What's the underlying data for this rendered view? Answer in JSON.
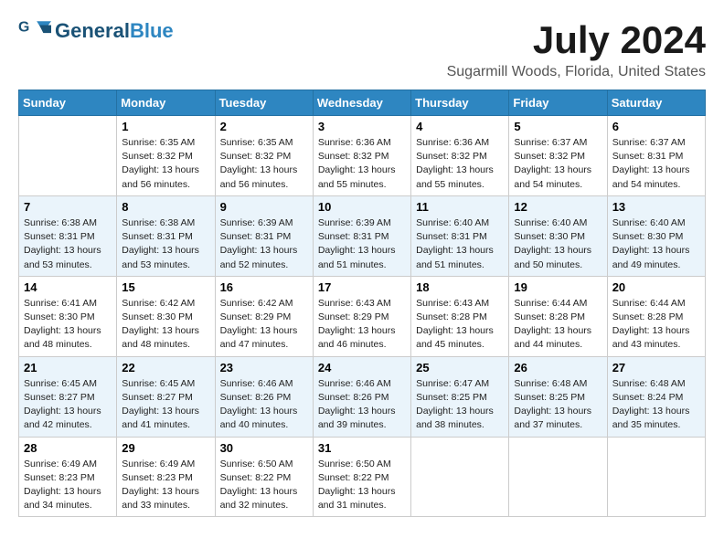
{
  "header": {
    "logo_general": "General",
    "logo_blue": "Blue",
    "month_title": "July 2024",
    "location": "Sugarmill Woods, Florida, United States"
  },
  "calendar": {
    "days_of_week": [
      "Sunday",
      "Monday",
      "Tuesday",
      "Wednesday",
      "Thursday",
      "Friday",
      "Saturday"
    ],
    "weeks": [
      [
        {
          "day": "",
          "info": ""
        },
        {
          "day": "1",
          "info": "Sunrise: 6:35 AM\nSunset: 8:32 PM\nDaylight: 13 hours\nand 56 minutes."
        },
        {
          "day": "2",
          "info": "Sunrise: 6:35 AM\nSunset: 8:32 PM\nDaylight: 13 hours\nand 56 minutes."
        },
        {
          "day": "3",
          "info": "Sunrise: 6:36 AM\nSunset: 8:32 PM\nDaylight: 13 hours\nand 55 minutes."
        },
        {
          "day": "4",
          "info": "Sunrise: 6:36 AM\nSunset: 8:32 PM\nDaylight: 13 hours\nand 55 minutes."
        },
        {
          "day": "5",
          "info": "Sunrise: 6:37 AM\nSunset: 8:32 PM\nDaylight: 13 hours\nand 54 minutes."
        },
        {
          "day": "6",
          "info": "Sunrise: 6:37 AM\nSunset: 8:31 PM\nDaylight: 13 hours\nand 54 minutes."
        }
      ],
      [
        {
          "day": "7",
          "info": "Sunrise: 6:38 AM\nSunset: 8:31 PM\nDaylight: 13 hours\nand 53 minutes."
        },
        {
          "day": "8",
          "info": "Sunrise: 6:38 AM\nSunset: 8:31 PM\nDaylight: 13 hours\nand 53 minutes."
        },
        {
          "day": "9",
          "info": "Sunrise: 6:39 AM\nSunset: 8:31 PM\nDaylight: 13 hours\nand 52 minutes."
        },
        {
          "day": "10",
          "info": "Sunrise: 6:39 AM\nSunset: 8:31 PM\nDaylight: 13 hours\nand 51 minutes."
        },
        {
          "day": "11",
          "info": "Sunrise: 6:40 AM\nSunset: 8:31 PM\nDaylight: 13 hours\nand 51 minutes."
        },
        {
          "day": "12",
          "info": "Sunrise: 6:40 AM\nSunset: 8:30 PM\nDaylight: 13 hours\nand 50 minutes."
        },
        {
          "day": "13",
          "info": "Sunrise: 6:40 AM\nSunset: 8:30 PM\nDaylight: 13 hours\nand 49 minutes."
        }
      ],
      [
        {
          "day": "14",
          "info": "Sunrise: 6:41 AM\nSunset: 8:30 PM\nDaylight: 13 hours\nand 48 minutes."
        },
        {
          "day": "15",
          "info": "Sunrise: 6:42 AM\nSunset: 8:30 PM\nDaylight: 13 hours\nand 48 minutes."
        },
        {
          "day": "16",
          "info": "Sunrise: 6:42 AM\nSunset: 8:29 PM\nDaylight: 13 hours\nand 47 minutes."
        },
        {
          "day": "17",
          "info": "Sunrise: 6:43 AM\nSunset: 8:29 PM\nDaylight: 13 hours\nand 46 minutes."
        },
        {
          "day": "18",
          "info": "Sunrise: 6:43 AM\nSunset: 8:28 PM\nDaylight: 13 hours\nand 45 minutes."
        },
        {
          "day": "19",
          "info": "Sunrise: 6:44 AM\nSunset: 8:28 PM\nDaylight: 13 hours\nand 44 minutes."
        },
        {
          "day": "20",
          "info": "Sunrise: 6:44 AM\nSunset: 8:28 PM\nDaylight: 13 hours\nand 43 minutes."
        }
      ],
      [
        {
          "day": "21",
          "info": "Sunrise: 6:45 AM\nSunset: 8:27 PM\nDaylight: 13 hours\nand 42 minutes."
        },
        {
          "day": "22",
          "info": "Sunrise: 6:45 AM\nSunset: 8:27 PM\nDaylight: 13 hours\nand 41 minutes."
        },
        {
          "day": "23",
          "info": "Sunrise: 6:46 AM\nSunset: 8:26 PM\nDaylight: 13 hours\nand 40 minutes."
        },
        {
          "day": "24",
          "info": "Sunrise: 6:46 AM\nSunset: 8:26 PM\nDaylight: 13 hours\nand 39 minutes."
        },
        {
          "day": "25",
          "info": "Sunrise: 6:47 AM\nSunset: 8:25 PM\nDaylight: 13 hours\nand 38 minutes."
        },
        {
          "day": "26",
          "info": "Sunrise: 6:48 AM\nSunset: 8:25 PM\nDaylight: 13 hours\nand 37 minutes."
        },
        {
          "day": "27",
          "info": "Sunrise: 6:48 AM\nSunset: 8:24 PM\nDaylight: 13 hours\nand 35 minutes."
        }
      ],
      [
        {
          "day": "28",
          "info": "Sunrise: 6:49 AM\nSunset: 8:23 PM\nDaylight: 13 hours\nand 34 minutes."
        },
        {
          "day": "29",
          "info": "Sunrise: 6:49 AM\nSunset: 8:23 PM\nDaylight: 13 hours\nand 33 minutes."
        },
        {
          "day": "30",
          "info": "Sunrise: 6:50 AM\nSunset: 8:22 PM\nDaylight: 13 hours\nand 32 minutes."
        },
        {
          "day": "31",
          "info": "Sunrise: 6:50 AM\nSunset: 8:22 PM\nDaylight: 13 hours\nand 31 minutes."
        },
        {
          "day": "",
          "info": ""
        },
        {
          "day": "",
          "info": ""
        },
        {
          "day": "",
          "info": ""
        }
      ]
    ]
  }
}
